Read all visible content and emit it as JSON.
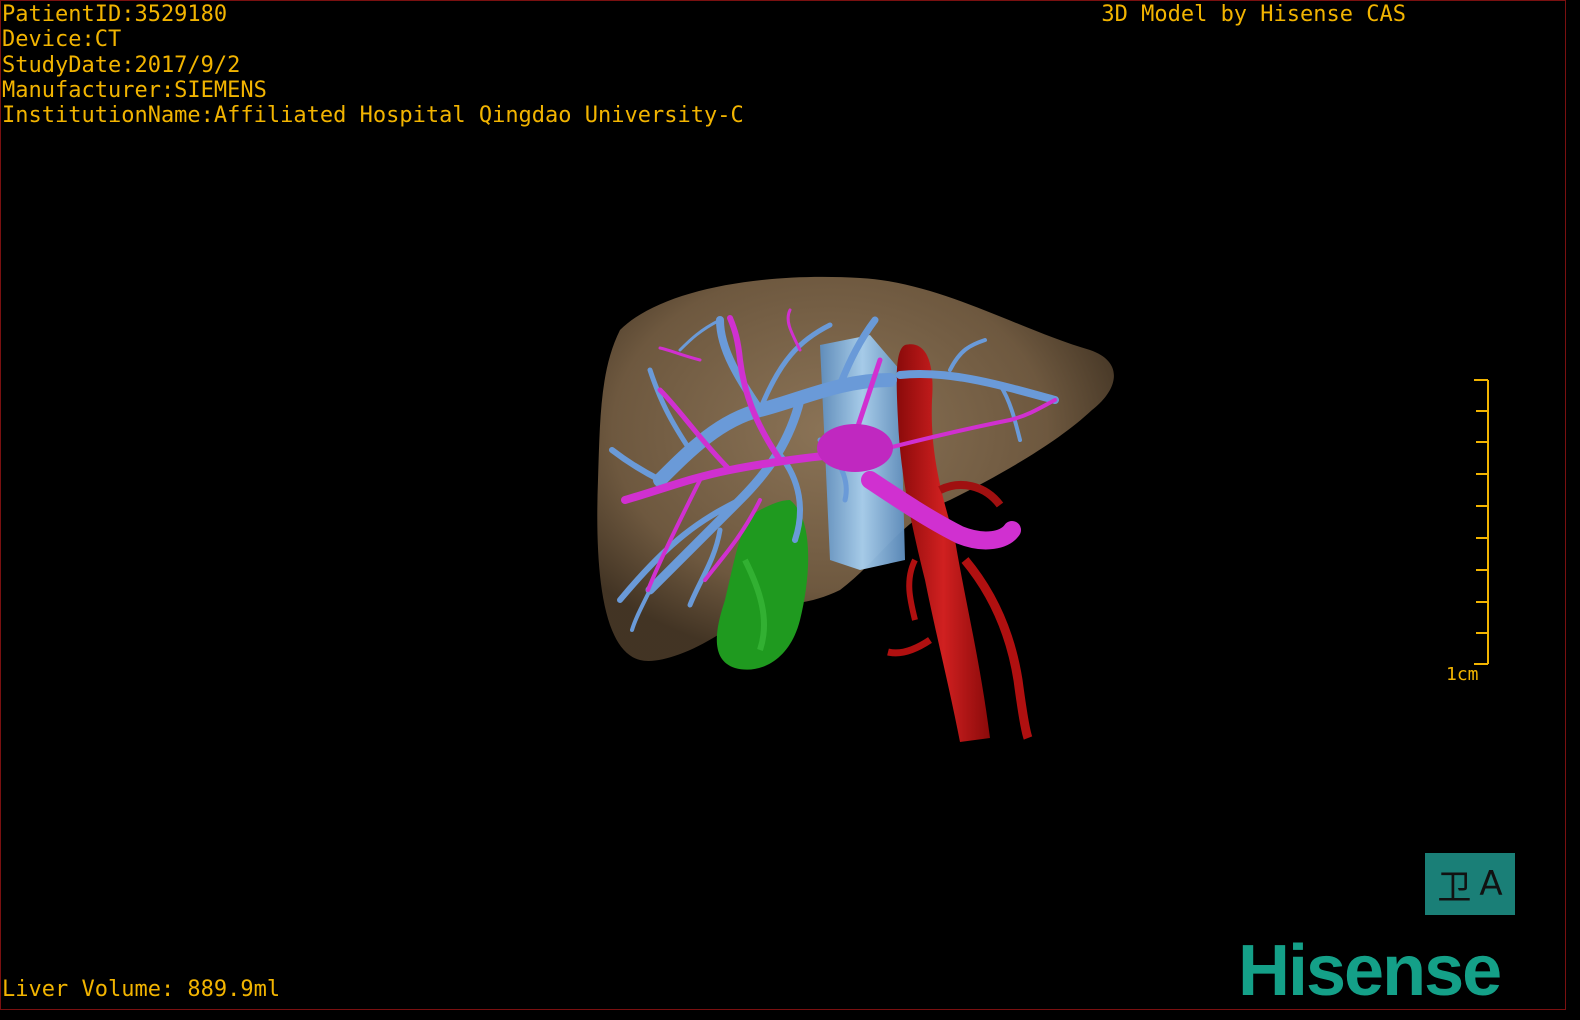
{
  "info": {
    "patient_id": "PatientID:3529180",
    "device": "Device:CT",
    "study_date": "StudyDate:2017/9/2",
    "manufacturer": "Manufacturer:SIEMENS",
    "institution": "InstitutionName:Affiliated Hospital Qingdao University-C"
  },
  "credit": "3D Model by Hisense CAS",
  "volume": "Liver Volume: 889.9ml",
  "scale_label": "1cm",
  "view_button": {
    "left_glyph": "卫",
    "right_glyph": "A"
  },
  "logo": "Hisense",
  "colors": {
    "text": "#f2b400",
    "liver": "#8a7050",
    "portal_vein": "#6a9ad8",
    "hepatic_vein": "#d030d0",
    "artery_aorta": "#c01818",
    "gallbladder": "#1f9a1f",
    "ivc": "#8fbfe6",
    "logo": "#14a088",
    "button": "#1a7f77"
  }
}
